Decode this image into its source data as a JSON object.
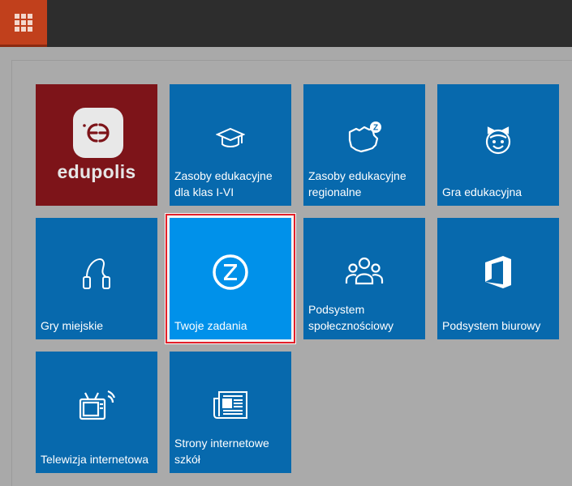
{
  "topbar": {
    "apps_icon": "grid-icon"
  },
  "tiles": [
    {
      "label": "",
      "brand": "edupolis",
      "icon": "edupolis-logo-icon"
    },
    {
      "label": "Zasoby edukacyjne dla klas I-VI",
      "icon": "graduation-cap-icon"
    },
    {
      "label": "Zasoby edukacyjne regionalne",
      "icon": "region-map-icon"
    },
    {
      "label": "Gra edukacyjna",
      "icon": "child-face-icon"
    },
    {
      "label": "Gry miejskie",
      "icon": "jump-rope-icon"
    },
    {
      "label": "Twoje zadania",
      "icon": "z-circle-icon"
    },
    {
      "label": "Podsystem społecznościowy",
      "icon": "people-group-icon"
    },
    {
      "label": "Podsystem biurowy",
      "icon": "office-icon"
    },
    {
      "label": "Telewizja internetowa",
      "icon": "tv-icon"
    },
    {
      "label": "Strony internetowe szkół",
      "icon": "newspaper-icon"
    }
  ],
  "colors": {
    "tile": "#0769ad",
    "tile_active": "#0091ea",
    "brand_tile": "#7d1419",
    "apps_button": "#c1401c",
    "topbar": "#2d2d2d",
    "highlight_border": "#e3202a"
  }
}
